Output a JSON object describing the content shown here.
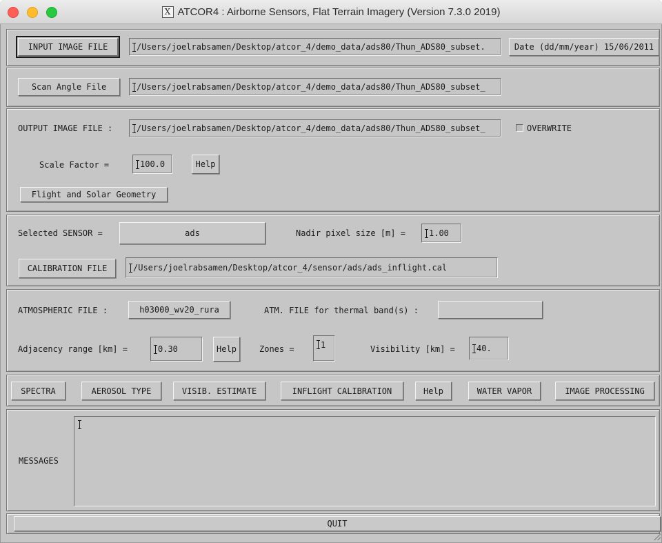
{
  "window": {
    "title": "ATCOR4 :  Airborne Sensors,  Flat Terrain Imagery  (Version 7.3.0  2019)"
  },
  "input_section": {
    "input_image_button": "INPUT IMAGE FILE",
    "input_image_path": "/Users/joelrabsamen/Desktop/atcor_4/demo_data/ads80/Thun_ADS80_subset.",
    "date_label": "Date (dd/mm/year) 15/06/2011"
  },
  "scan_section": {
    "scan_angle_button": "Scan Angle File",
    "scan_angle_path": "/Users/joelrabsamen/Desktop/atcor_4/demo_data/ads80/Thun_ADS80_subset_"
  },
  "output_section": {
    "output_label": "OUTPUT IMAGE FILE :",
    "output_path": "/Users/joelrabsamen/Desktop/atcor_4/demo_data/ads80/Thun_ADS80_subset_",
    "overwrite_label": "OVERWRITE",
    "scale_factor_label": "Scale Factor =",
    "scale_factor_value": "100.0",
    "help_label": "Help",
    "flight_geometry_button": "Flight and Solar Geometry"
  },
  "sensor_section": {
    "selected_sensor_label": "Selected SENSOR =",
    "selected_sensor_value": "ads",
    "nadir_label": "Nadir pixel size [m] =",
    "nadir_value": "1.00",
    "calibration_button": "CALIBRATION FILE",
    "calibration_path": "/Users/joelrabsamen/Desktop/atcor_4/sensor/ads/ads_inflight.cal"
  },
  "atmosphere_section": {
    "atm_file_label": "ATMOSPHERIC FILE :",
    "atm_file_button": "h03000_wv20_rura",
    "thermal_label": "ATM. FILE for thermal band(s) :",
    "thermal_value": "",
    "adjacency_label": "Adjacency range [km] =",
    "adjacency_value": "0.30",
    "help_label": "Help",
    "zones_label": "Zones =",
    "zones_value": "1",
    "visibility_label": "Visibility [km] =",
    "visibility_value": "40."
  },
  "toolbar": {
    "spectra": "SPECTRA",
    "aerosol_type": "AEROSOL TYPE",
    "visib_estimate": "VISIB. ESTIMATE",
    "inflight_calibration": "INFLIGHT CALIBRATION",
    "help": "Help",
    "water_vapor": "WATER VAPOR",
    "image_processing": "IMAGE PROCESSING"
  },
  "messages": {
    "label": "MESSAGES",
    "value": ""
  },
  "footer": {
    "quit": "QUIT"
  }
}
